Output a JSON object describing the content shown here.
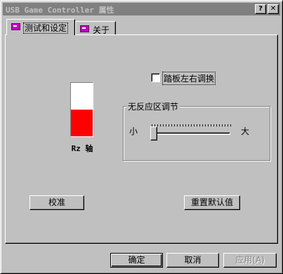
{
  "window": {
    "title": "USB Game Controller 属性",
    "help_glyph": "?",
    "close_glyph": "✕"
  },
  "tabs": [
    {
      "label": "测试和设定",
      "active": true
    },
    {
      "label": "关于",
      "active": false
    }
  ],
  "meter": {
    "label": "Rz 轴",
    "fill_fraction": 0.5,
    "fill_color": "#ff0000",
    "empty_color": "#ffffff"
  },
  "checkbox": {
    "label": "踏板左右调换",
    "checked": false
  },
  "deadzone": {
    "title": "无反应区调节",
    "min_label": "小",
    "max_label": "大",
    "value_fraction": 0.0
  },
  "buttons": {
    "calibrate": "校准",
    "reset_defaults": "重置默认值",
    "ok": "确定",
    "cancel": "取消",
    "apply": "应用(A)"
  }
}
